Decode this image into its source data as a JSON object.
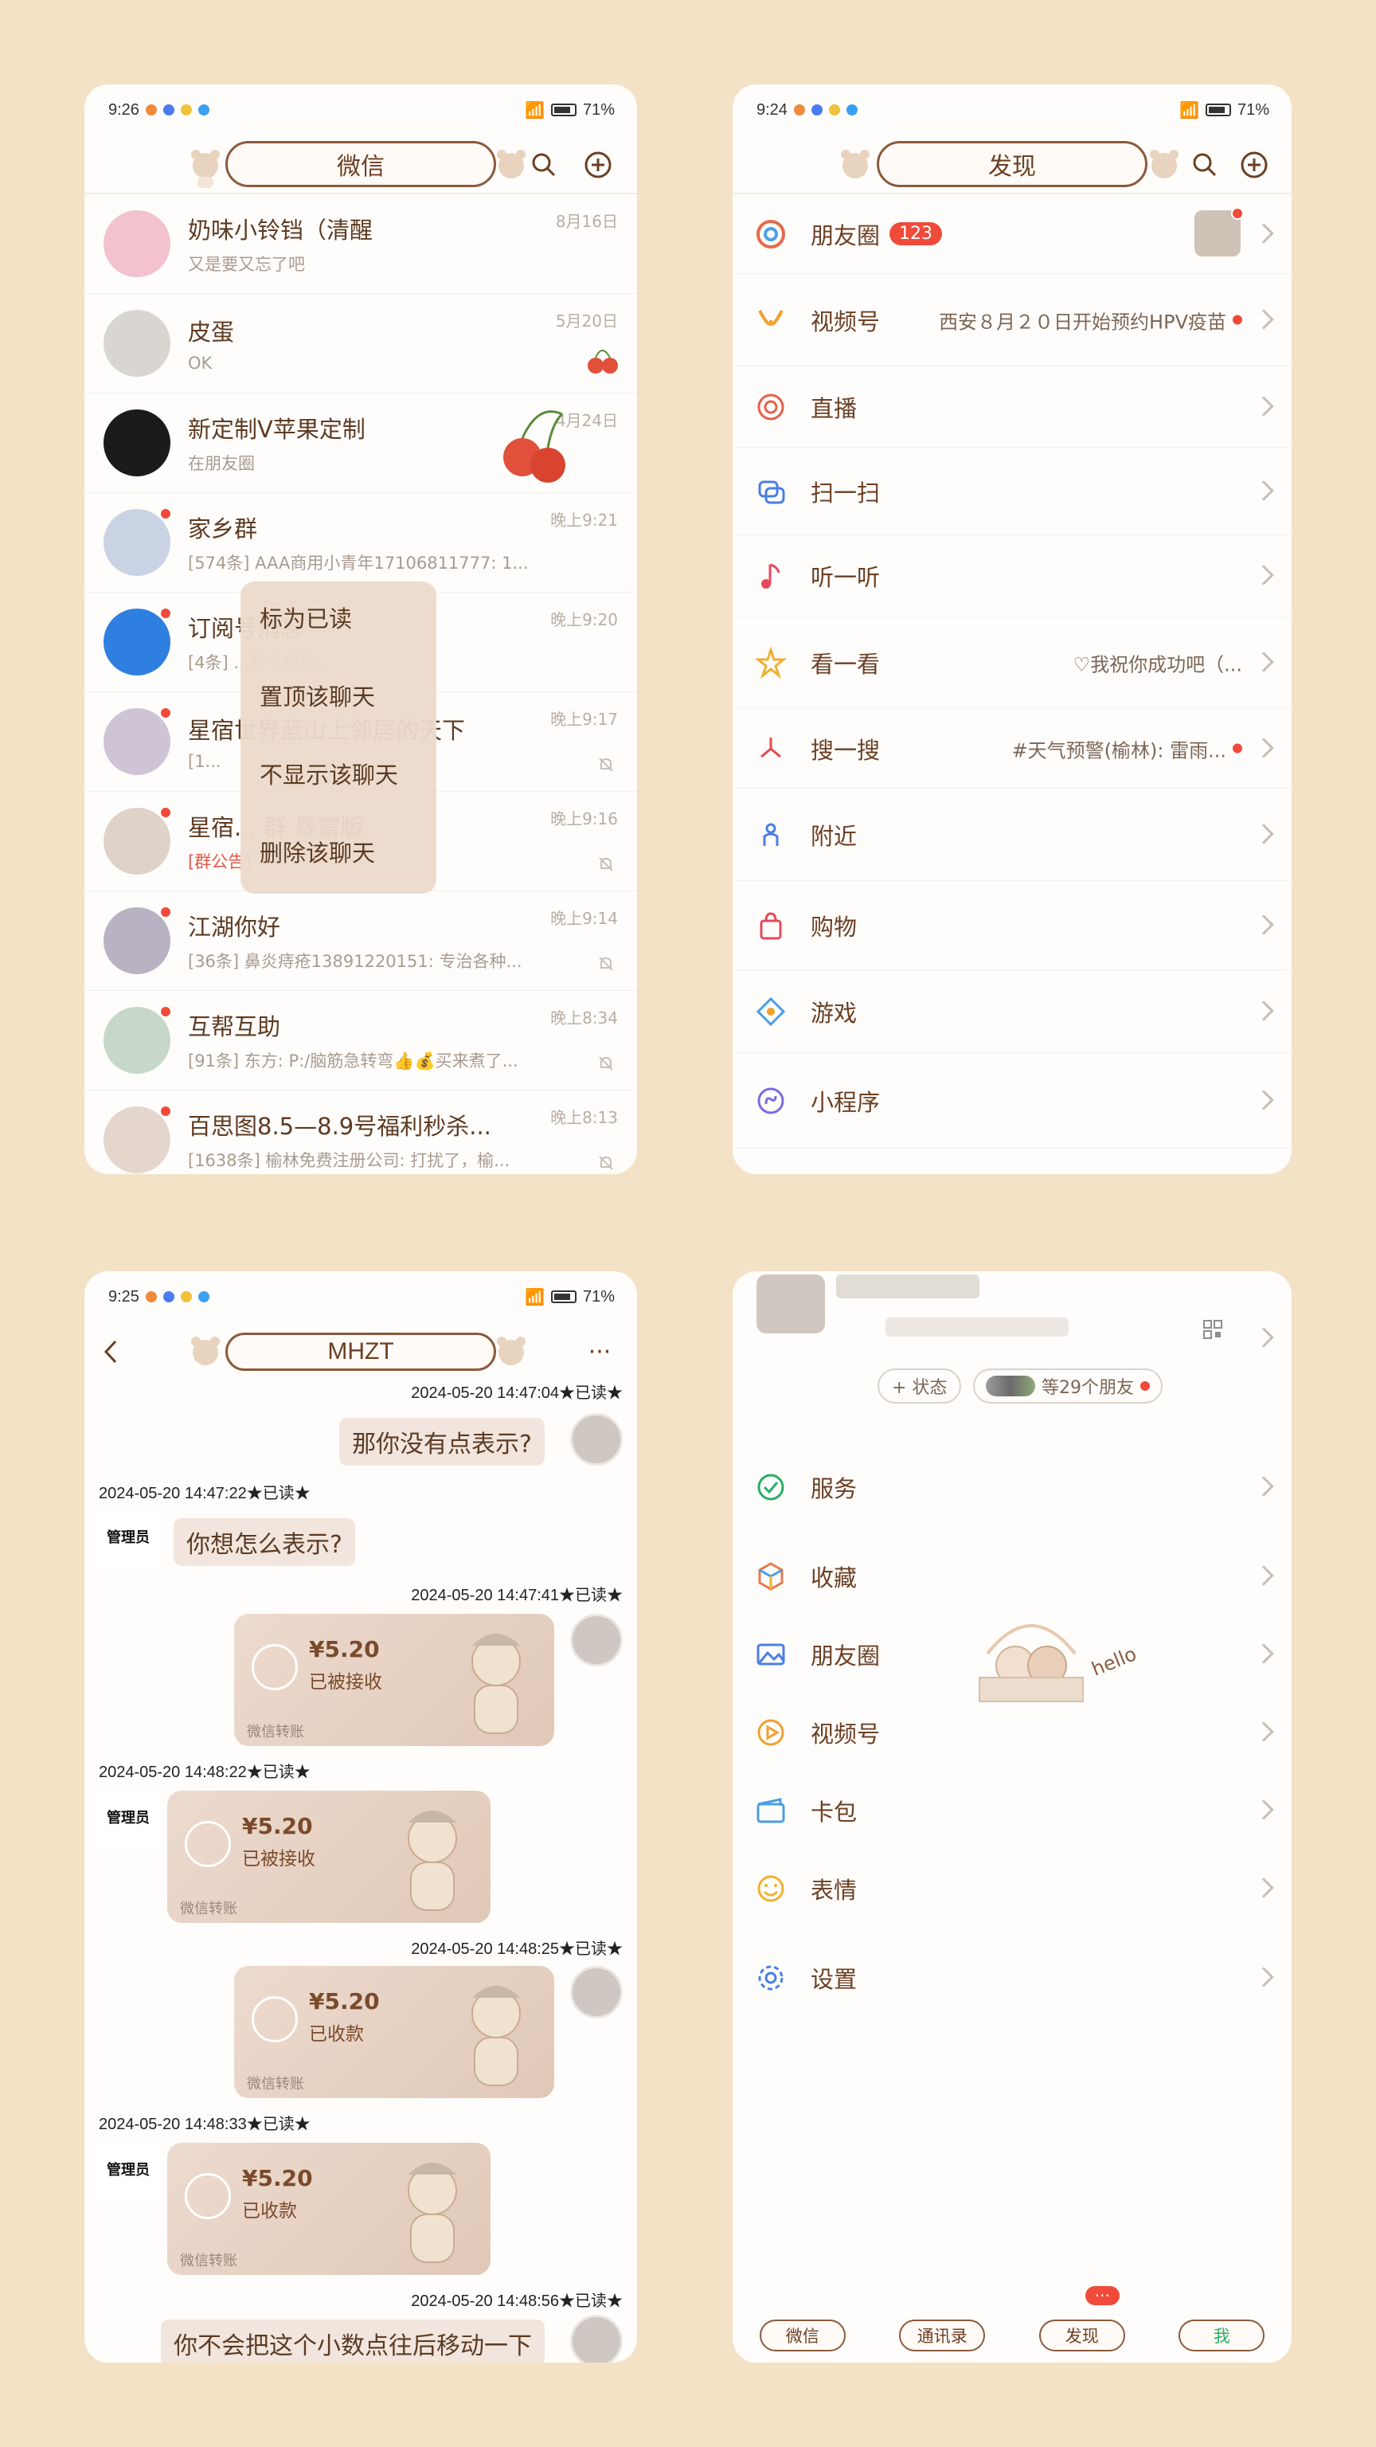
{
  "panel1": {
    "status": {
      "time": "9:26",
      "battery": "71%"
    },
    "title": "微信",
    "chats": [
      {
        "name": "奶味小铃铛（清醒",
        "msg": "又是要又忘了吧",
        "time": "8月16日"
      },
      {
        "name": "皮蛋",
        "msg": "OK",
        "time": "5月20日"
      },
      {
        "name": "新定制V苹果定制",
        "msg": "在朋友圈",
        "time": "4月24日"
      },
      {
        "name": "家乡群",
        "msg": "[574条] AAA商用小青年17106811777: 1...",
        "time": "晚上9:21"
      },
      {
        "name": "订阅号消息",
        "msg": "[4条] ...罗手机壁...",
        "time": "晚上9:20"
      },
      {
        "name": "星宿世界蓝山上邻居的天下",
        "msg": "[1...",
        "time": "晚上9:17"
      },
      {
        "name": "星宿... 群 暴富版",
        "msg": "[群公告]",
        "time": "晚上9:16"
      },
      {
        "name": "江湖你好",
        "msg": "[36条] 鼻炎痔疮13891220151: 专治各种...",
        "time": "晚上9:14"
      },
      {
        "name": "互帮互助",
        "msg": "[91条] 东方: P:/脑筋急转弯👍💰买来煮了...",
        "time": "晚上8:34"
      },
      {
        "name": "百思图8.5—8.9号福利秒杀...",
        "msg": "[1638条] 榆林免费注册公司: 打扰了，榆...",
        "time": "晚上8:13"
      }
    ],
    "context_menu": [
      "标为已读",
      "置顶该聊天",
      "不显示该聊天",
      "删除该聊天"
    ]
  },
  "panel2": {
    "status": {
      "time": "9:24",
      "battery": "71%"
    },
    "title": "发现",
    "items": [
      {
        "label": "朋友圈",
        "badge": "123"
      },
      {
        "label": "视频号",
        "right": "西安８月２０日开始预约HPV疫苗"
      },
      {
        "label": "直播"
      },
      {
        "label": "扫一扫"
      },
      {
        "label": "听一听"
      },
      {
        "label": "看一看",
        "right": "♡我祝你成功吧（..."
      },
      {
        "label": "搜一搜",
        "right": "#天气预警(榆林): 雷雨..."
      },
      {
        "label": "附近"
      },
      {
        "label": "购物"
      },
      {
        "label": "游戏"
      },
      {
        "label": "小程序"
      }
    ]
  },
  "panel3": {
    "status": {
      "time": "9:25",
      "battery": "71%"
    },
    "title": "MHZT",
    "admin_label": "管理员",
    "messages": {
      "ts1": "2024-05-20 14:47:04★已读★",
      "out1": "那你没有点表示?",
      "ts2": "2024-05-20 14:47:22★已读★",
      "in1": "你想怎么表示?",
      "ts3": "2024-05-20 14:47:41★已读★",
      "ts4": "2024-05-20 14:48:22★已读★",
      "ts5": "2024-05-20 14:48:25★已读★",
      "ts6": "2024-05-20 14:48:33★已读★",
      "ts7": "2024-05-20 14:48:56★已读★",
      "out2": "你不会把这个小数点往后移动一下"
    },
    "transfers": [
      {
        "amount": "¥5.20",
        "status": "已被接收",
        "footer": "微信转账"
      },
      {
        "amount": "¥5.20",
        "status": "已被接收",
        "footer": "微信转账"
      },
      {
        "amount": "¥5.20",
        "status": "已收款",
        "footer": "微信转账"
      },
      {
        "amount": "¥5.20",
        "status": "已收款",
        "footer": "微信转账"
      }
    ]
  },
  "panel4": {
    "status_btn": "+ 状态",
    "friends_btn": "等29个朋友",
    "items": [
      "服务",
      "收藏",
      "朋友圈",
      "视频号",
      "卡包",
      "表情",
      "设置"
    ],
    "deco_text": "hello",
    "tabs": [
      "微信",
      "通讯录",
      "发现",
      "我"
    ],
    "tab_badge": "···"
  },
  "colors": {
    "accent": "#6b3f24",
    "background": "#f4e2c6",
    "red": "#f04a3b",
    "bubble": "#f1e5dd"
  }
}
